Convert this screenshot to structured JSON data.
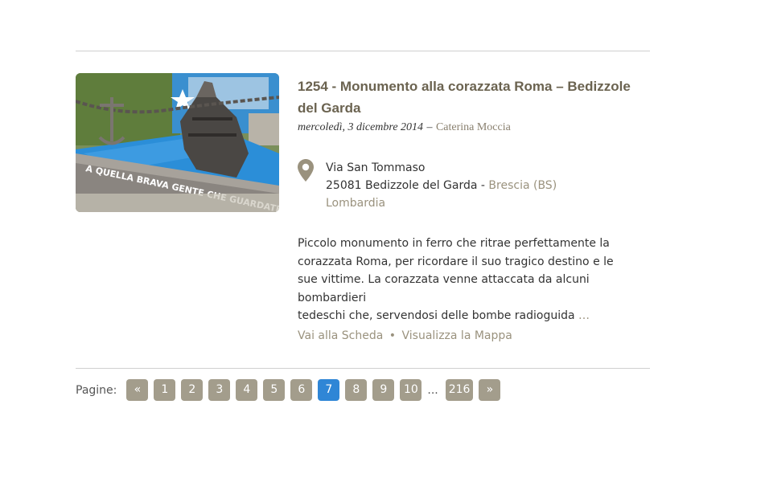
{
  "post": {
    "title": "1254 - Monumento alla corazzata Roma – Bedizzole del Garda",
    "date": "mercoledì, 3 dicembre 2014",
    "dash": "–",
    "author": "Caterina Moccia",
    "address": {
      "street": "Via San Tommaso",
      "city": "25081 Bedizzole del Garda -",
      "province": "Brescia (BS)",
      "region": "Lombardia"
    },
    "excerpt": "Piccolo monumento in ferro che ritrae perfettamente la\ncorazzata Roma, per ricordare il suo tragico destino e le\nsue vittime. La corazzata venne attaccata da alcuni bombardieri\ntedeschi che, servendosi delle bombe radioguida",
    "excerpt_more": "…",
    "actions": {
      "scheda": "Vai alla Scheda",
      "separator": "•",
      "mappa": "Visualizza la Mappa"
    },
    "image_text": "A QUELLA BRAVA GENTE CHE GUARDATE IL MARE SENZA TOMBE E SENZA CIPRESSI"
  },
  "pagination": {
    "label": "Pagine:",
    "prev": "«",
    "pages": [
      "1",
      "2",
      "3",
      "4",
      "5",
      "6",
      "7",
      "8",
      "9",
      "10"
    ],
    "current": "7",
    "ellipsis": "...",
    "last": "216",
    "next": "»"
  },
  "colors": {
    "accent": "#2f86d6",
    "button": "#a39d8c",
    "link": "#9a927e",
    "title": "#6b6350"
  }
}
